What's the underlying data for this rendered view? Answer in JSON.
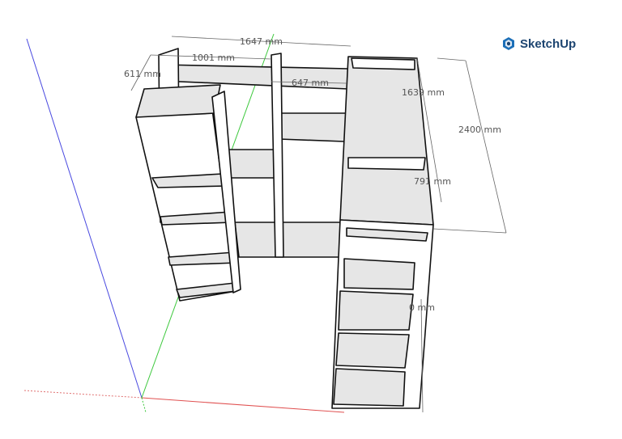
{
  "app": {
    "logo_text": "SketchUp",
    "logo_color": "#1c4470"
  },
  "dimensions": [
    {
      "id": "overall-width",
      "label": "1647 mm"
    },
    {
      "id": "left-width",
      "label": "1001 mm"
    },
    {
      "id": "depth",
      "label": "611 mm"
    },
    {
      "id": "middle-width",
      "label": "647 mm"
    },
    {
      "id": "right-depth",
      "label": "1639 mm"
    },
    {
      "id": "height",
      "label": "2400 mm"
    },
    {
      "id": "right-mid",
      "label": "791 mm"
    },
    {
      "id": "right-lower",
      "label": "0 mm"
    }
  ],
  "axes": {
    "red": "#e05050",
    "green": "#3cc83c",
    "blue": "#4040e0"
  }
}
